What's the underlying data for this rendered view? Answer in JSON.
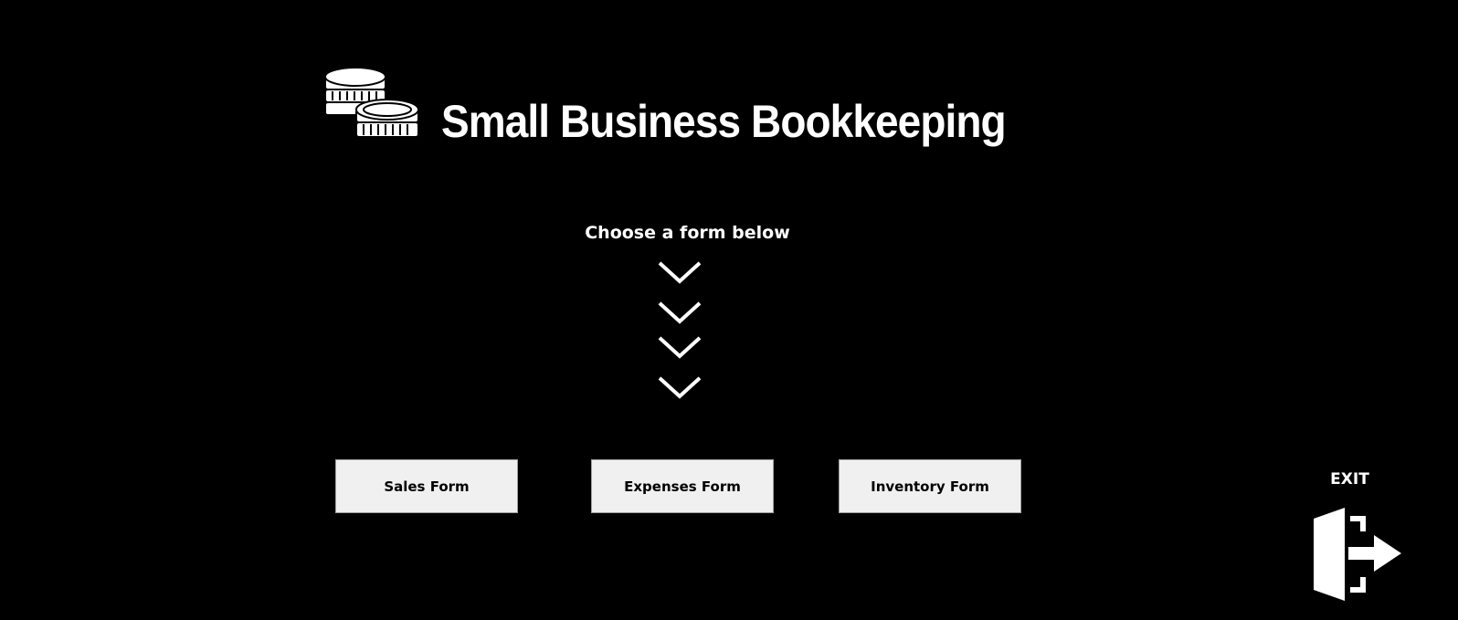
{
  "header": {
    "title": "Small Business Bookkeeping",
    "logo_icon": "coins-stack-icon"
  },
  "main": {
    "prompt": "Choose a form below",
    "chevron_icon": "chevron-down-icon",
    "chevron_count": 4,
    "buttons": {
      "sales": "Sales Form",
      "expenses": "Expenses Form",
      "inventory": "Inventory Form"
    }
  },
  "exit": {
    "label": "EXIT",
    "icon": "exit-door-icon"
  },
  "colors": {
    "background": "#000000",
    "foreground": "#ffffff",
    "button_bg": "#f0f0f0",
    "button_border": "#a0a0a0"
  }
}
